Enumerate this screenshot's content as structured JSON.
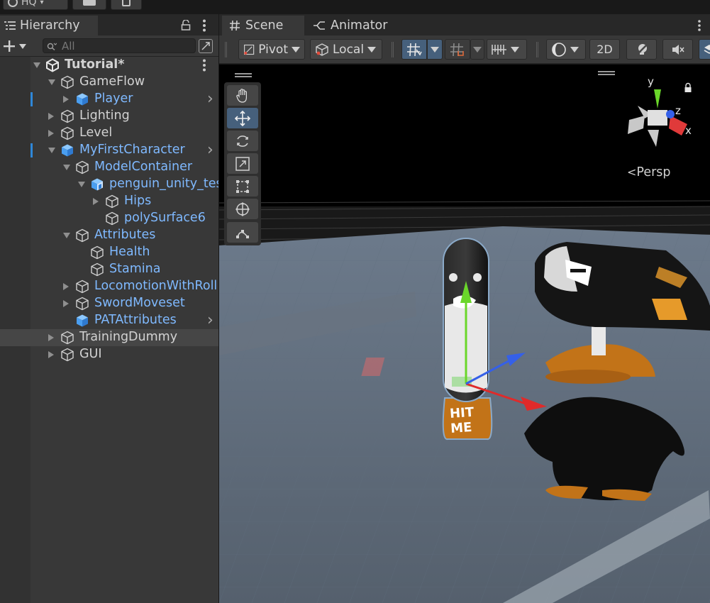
{
  "top": {
    "layout_label": "HQ"
  },
  "hierarchy": {
    "tab_label": "Hierarchy",
    "search_placeholder": "All",
    "rows": [
      {
        "label": "Tutorial*",
        "depth": 0,
        "expand": "down",
        "icon": "unity-scene-icon",
        "style": "bold",
        "menu": true
      },
      {
        "label": "GameFlow",
        "depth": 1,
        "expand": "down",
        "icon": "gameobject-icon",
        "style": "normal"
      },
      {
        "label": "Player",
        "depth": 2,
        "expand": "right",
        "icon": "prefab-icon",
        "style": "prefab",
        "chevron": true,
        "marker": true
      },
      {
        "label": "Lighting",
        "depth": 1,
        "expand": "right",
        "icon": "gameobject-icon",
        "style": "normal"
      },
      {
        "label": "Level",
        "depth": 1,
        "expand": "right",
        "icon": "gameobject-icon",
        "style": "normal"
      },
      {
        "label": "MyFirstCharacter",
        "depth": 1,
        "expand": "down",
        "icon": "prefab-icon",
        "style": "prefab",
        "chevron": true,
        "marker": true
      },
      {
        "label": "ModelContainer",
        "depth": 2,
        "expand": "down",
        "icon": "gameobject-icon",
        "style": "prefab"
      },
      {
        "label": "penguin_unity_tes",
        "depth": 3,
        "expand": "down",
        "icon": "model-prefab-icon",
        "style": "prefab"
      },
      {
        "label": "Hips",
        "depth": 4,
        "expand": "right",
        "icon": "gameobject-icon",
        "style": "prefab"
      },
      {
        "label": "polySurface6",
        "depth": 4,
        "expand": "none",
        "icon": "gameobject-icon",
        "style": "prefab"
      },
      {
        "label": "Attributes",
        "depth": 2,
        "expand": "down",
        "icon": "gameobject-icon",
        "style": "prefab"
      },
      {
        "label": "Health",
        "depth": 3,
        "expand": "none",
        "icon": "gameobject-icon",
        "style": "prefab"
      },
      {
        "label": "Stamina",
        "depth": 3,
        "expand": "none",
        "icon": "gameobject-icon",
        "style": "prefab"
      },
      {
        "label": "LocomotionWithRoll",
        "depth": 2,
        "expand": "right",
        "icon": "gameobject-icon",
        "style": "prefab"
      },
      {
        "label": "SwordMoveset",
        "depth": 2,
        "expand": "right",
        "icon": "gameobject-icon",
        "style": "prefab"
      },
      {
        "label": "PATAttributes",
        "depth": 2,
        "expand": "none",
        "icon": "prefab-icon",
        "style": "prefab",
        "chevron": true
      },
      {
        "label": "TrainingDummy",
        "depth": 1,
        "expand": "right",
        "icon": "gameobject-icon",
        "style": "normal",
        "selected": true
      },
      {
        "label": "GUI",
        "depth": 1,
        "expand": "right",
        "icon": "gameobject-icon",
        "style": "normal"
      }
    ]
  },
  "scene": {
    "tabs": [
      {
        "label": "Scene",
        "icon": "hash-icon"
      },
      {
        "label": "Animator",
        "icon": "animator-icon"
      }
    ],
    "toolbar": {
      "pivot_label": "Pivot",
      "local_label": "Local",
      "mode_2d_label": "2D"
    },
    "gizmo": {
      "y_label": "y",
      "z_label": "z",
      "x_label": "x",
      "persp_label": "Persp"
    },
    "dummy_text": [
      "HIT",
      "ME"
    ]
  },
  "colors": {
    "accent_blue": "#2f87d8",
    "prefab_text": "#7fb9ff",
    "active_tool": "#46607c",
    "axis_x": "#e02a2a",
    "axis_y": "#6ad62a",
    "axis_z": "#3560e8"
  }
}
